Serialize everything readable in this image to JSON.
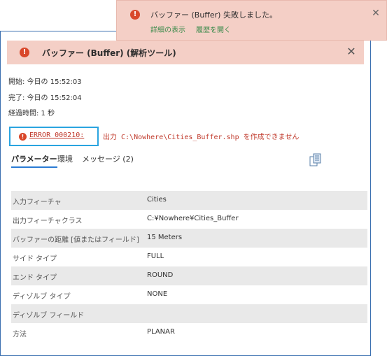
{
  "toast": {
    "message": "バッファー (Buffer) 失敗しました。",
    "link_details": "詳細の表示",
    "link_history": "履歴を開く",
    "close_label": "✕"
  },
  "header": {
    "title": "バッファー (Buffer) (解析ツール)",
    "error_glyph": "!",
    "close_label": "✕"
  },
  "timing": {
    "start": "開始: 今日の 15:52:03",
    "end": "完了: 今日の 15:52:04",
    "elapsed": "経過時間: 1 秒"
  },
  "error": {
    "code": "ERROR 000210:",
    "message": "出力 C:\\Nowhere\\Cities_Buffer.shp を作成できません"
  },
  "tabs": {
    "parameters": "パラメーター",
    "environments": "環境",
    "messages": "メッセージ (2)"
  },
  "params": [
    {
      "name": "入力フィーチャ",
      "value": "Cities"
    },
    {
      "name": "出力フィーチャクラス",
      "value": "C:¥Nowhere¥Cities_Buffer"
    },
    {
      "name": "バッファーの距離 [値またはフィールド]",
      "value": "15 Meters"
    },
    {
      "name": "サイド タイプ",
      "value": "FULL"
    },
    {
      "name": "エンド タイプ",
      "value": "ROUND"
    },
    {
      "name": "ディゾルブ タイプ",
      "value": "NONE"
    },
    {
      "name": "ディゾルブ フィールド",
      "value": ""
    },
    {
      "name": "方法",
      "value": "PLANAR"
    }
  ],
  "colors": {
    "error_bg": "#f4cfc6",
    "error_red": "#c0392b",
    "accent_blue": "#2a7bd4",
    "link_green": "#3a8a4a"
  }
}
